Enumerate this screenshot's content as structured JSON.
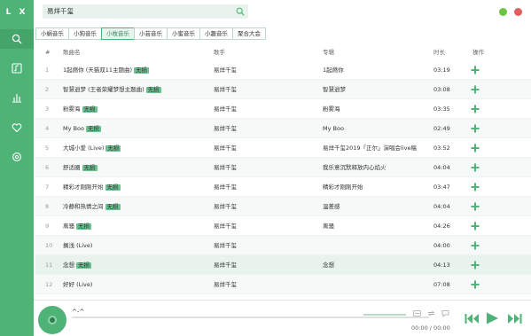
{
  "app": {
    "logo": "L X"
  },
  "search": {
    "query": "易烊千玺"
  },
  "tabs": [
    "小蜗音乐",
    "小狗音乐",
    "小枚音乐",
    "小芸音乐",
    "小蜜音乐",
    "小趣音乐",
    "聚合大会"
  ],
  "active_tab": "小枚音乐",
  "table": {
    "headers": {
      "num": "#",
      "title": "歌曲名",
      "artist": "歌手",
      "album": "专辑",
      "duration": "时长",
      "actions": "操作"
    },
    "rows": [
      {
        "num": "1",
        "title": "1起燃你 (天猫双11主题曲)",
        "badge": "无损",
        "artist": "易烊千玺",
        "album": "1起燃你",
        "duration": "03:19"
      },
      {
        "num": "2",
        "title": "智慧逍梦 (王者荣耀梦想主题曲)",
        "badge": "无损",
        "artist": "易烊千玺",
        "album": "智慧逍梦",
        "duration": "03:08"
      },
      {
        "num": "3",
        "title": "粉雾海",
        "badge": "无损",
        "artist": "易烊千玺",
        "album": "粉雾海",
        "duration": "03:35"
      },
      {
        "num": "4",
        "title": "My Boo",
        "badge": "无损",
        "artist": "易烊千玺",
        "album": "My Boo",
        "duration": "02:49"
      },
      {
        "num": "5",
        "title": "大城小爱 (Live)",
        "badge": "无损",
        "artist": "易烊千玺",
        "album": "易烊千玺2019「正尔」演唱会live稿",
        "duration": "03:52"
      },
      {
        "num": "6",
        "title": "舒适圈",
        "badge": "无损",
        "artist": "易烊千玺",
        "album": "我乐意沉默释放内心焰火",
        "duration": "04:04"
      },
      {
        "num": "7",
        "title": "精彩才刚刚开始",
        "badge": "无损",
        "artist": "易烊千玺",
        "album": "精彩才刚刚开始",
        "duration": "03:47"
      },
      {
        "num": "8",
        "title": "冷静和热情之间",
        "badge": "无损",
        "artist": "易烊千玺",
        "album": "温差感",
        "duration": "04:04"
      },
      {
        "num": "9",
        "title": "离骚",
        "badge": "无损",
        "artist": "易烊千玺",
        "album": "离骚",
        "duration": "04:26"
      },
      {
        "num": "10",
        "title": "搁浅 (Live)",
        "badge": "",
        "artist": "易烊千玺",
        "album": "",
        "duration": "04:00"
      },
      {
        "num": "11",
        "title": "念想",
        "badge": "无损",
        "artist": "易烊千玺",
        "album": "念想",
        "duration": "04:13"
      },
      {
        "num": "12",
        "title": "好好 (Live)",
        "badge": "",
        "artist": "易烊千玺",
        "album": "",
        "duration": "07:08"
      }
    ]
  },
  "player": {
    "title": "^-^",
    "time": "00:00 / 00:00"
  },
  "colors": {
    "accent": "#4fb377",
    "window_min": "#6cc644",
    "window_close": "#e05e5e"
  }
}
